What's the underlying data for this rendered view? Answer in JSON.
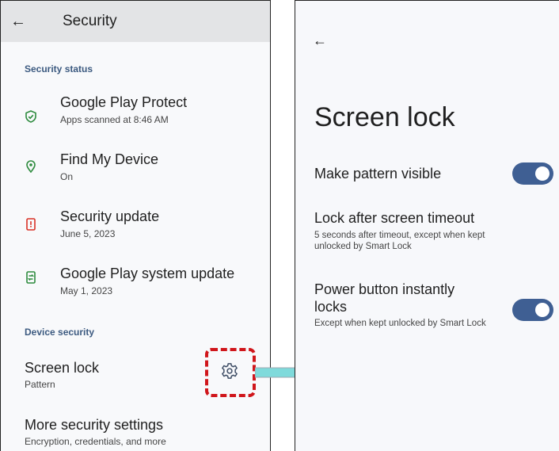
{
  "left": {
    "back_icon": "arrow-left",
    "title": "Security",
    "section_status": "Security status",
    "items": [
      {
        "title": "Google Play Protect",
        "subtitle": "Apps scanned at 8:46 AM",
        "icon": "shield-check-icon",
        "color": "#2e8b3e"
      },
      {
        "title": "Find My Device",
        "subtitle": "On",
        "icon": "location-pin-icon",
        "color": "#2e8b3e"
      },
      {
        "title": "Security update",
        "subtitle": "June 5, 2023",
        "icon": "phone-alert-icon",
        "color": "#d93025"
      },
      {
        "title": "Google Play system update",
        "subtitle": "May 1, 2023",
        "icon": "phone-update-icon",
        "color": "#2e8b3e"
      }
    ],
    "section_device": "Device security",
    "screen_lock": {
      "title": "Screen lock",
      "subtitle": "Pattern",
      "icon": "gear-icon"
    },
    "more": {
      "title": "More security settings",
      "subtitle": "Encryption, credentials, and more"
    }
  },
  "right": {
    "back_icon": "arrow-left",
    "title": "Screen lock",
    "settings": [
      {
        "title": "Make pattern visible",
        "subtitle": "",
        "toggle": "on"
      },
      {
        "title": "Lock after screen timeout",
        "subtitle": "5 seconds after timeout, except when kept unlocked by Smart Lock"
      },
      {
        "title": "Power button instantly locks",
        "subtitle": "Except when kept unlocked by Smart Lock",
        "toggle": "on"
      }
    ]
  },
  "colors": {
    "accent": "#3f5f93",
    "highlight": "#d0161b",
    "arrow": "#7fdadb"
  }
}
